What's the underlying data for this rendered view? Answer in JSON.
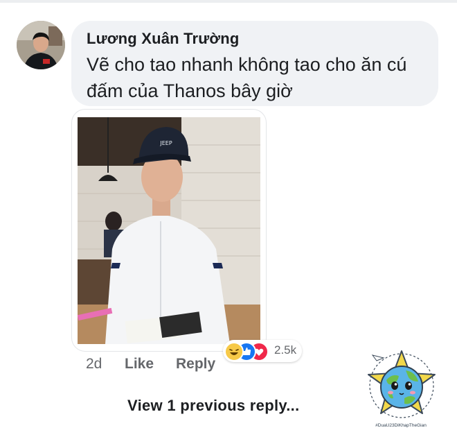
{
  "comment": {
    "author": "Lương Xuân Trường",
    "text": "Vẽ cho tao nhanh không tao cho ăn cú đấm của Thanos bây giờ"
  },
  "reactions": {
    "icons": [
      "haha-icon",
      "like-icon",
      "love-icon"
    ],
    "count": "2.5k"
  },
  "actions": {
    "time": "2d",
    "like_label": "Like",
    "reply_label": "Reply"
  },
  "replies": {
    "view_previous_label": "View 1 previous reply..."
  },
  "watermark": {
    "tag": "#DuaU23DiKhapTheGian"
  },
  "colors": {
    "bubble_bg": "#f0f2f5",
    "secondary_text": "#65676b",
    "like_blue": "#1877f2",
    "love_red": "#f0284a",
    "haha_yellow": "#f7c948"
  }
}
